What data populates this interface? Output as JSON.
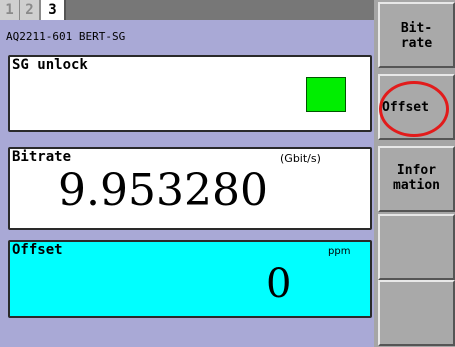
{
  "tabs": [
    {
      "label": "1",
      "active": false
    },
    {
      "label": "2",
      "active": false
    },
    {
      "label": "3",
      "active": true
    }
  ],
  "model": "AQ2211-601 BERT-SG",
  "sg": {
    "title": "SG unlock",
    "indicator_color": "#00ee00"
  },
  "bitrate": {
    "title": "Bitrate",
    "unit": "(Gbit/s)",
    "value": "9.953280"
  },
  "offset": {
    "title": "Offset",
    "unit": "ppm",
    "value": "0",
    "bg_color": "#00ffff"
  },
  "softkeys": [
    {
      "line1": "Bit-",
      "line2": "rate"
    },
    {
      "line1": "Offset",
      "line2": "",
      "highlighted": true
    },
    {
      "line1": "Infor",
      "line2": "mation"
    },
    {
      "line1": "",
      "line2": ""
    },
    {
      "line1": "",
      "line2": ""
    }
  ],
  "highlight_color": "#e21b1b"
}
